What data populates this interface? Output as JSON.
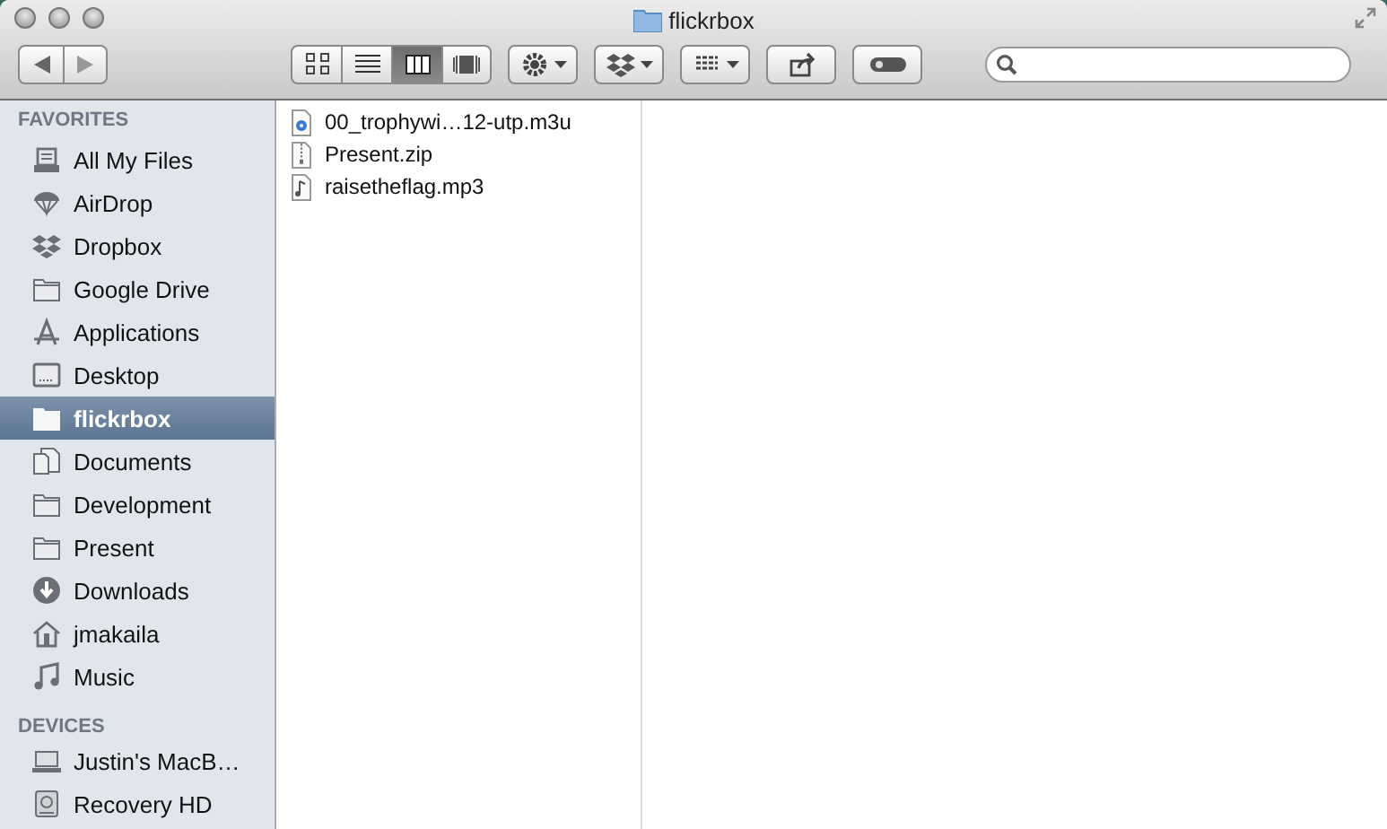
{
  "window": {
    "title": "flickrbox"
  },
  "toolbar": {
    "view_buttons": [
      {
        "kind": "icons",
        "selected": false
      },
      {
        "kind": "list",
        "selected": false
      },
      {
        "kind": "columns",
        "selected": true
      },
      {
        "kind": "coverflow",
        "selected": false
      }
    ],
    "tools": [
      {
        "kind": "gear"
      },
      {
        "kind": "dropbox"
      },
      {
        "kind": "arrange"
      },
      {
        "kind": "share"
      },
      {
        "kind": "toggle"
      }
    ]
  },
  "sidebar": {
    "sections": [
      {
        "header": "FAVORITES",
        "items": [
          {
            "label": "All My Files",
            "kind": "files",
            "selected": false
          },
          {
            "label": "AirDrop",
            "kind": "airdrop",
            "selected": false
          },
          {
            "label": "Dropbox",
            "kind": "dropbox",
            "selected": false
          },
          {
            "label": "Google Drive",
            "kind": "folder",
            "selected": false
          },
          {
            "label": "Applications",
            "kind": "apps",
            "selected": false
          },
          {
            "label": "Desktop",
            "kind": "desktop",
            "selected": false
          },
          {
            "label": "flickrbox",
            "kind": "folder",
            "selected": true
          },
          {
            "label": "Documents",
            "kind": "documents",
            "selected": false
          },
          {
            "label": "Development",
            "kind": "folder",
            "selected": false
          },
          {
            "label": "Present",
            "kind": "folder",
            "selected": false
          },
          {
            "label": "Downloads",
            "kind": "download",
            "selected": false
          },
          {
            "label": "jmakaila",
            "kind": "home",
            "selected": false
          },
          {
            "label": "Music",
            "kind": "music",
            "selected": false
          }
        ]
      },
      {
        "header": "DEVICES",
        "items": [
          {
            "label": "Justin's MacB…",
            "kind": "laptop",
            "selected": false
          },
          {
            "label": "Recovery HD",
            "kind": "disk",
            "selected": false
          }
        ]
      }
    ]
  },
  "columns": [
    {
      "files": [
        {
          "name": "00_trophywi…12-utp.m3u",
          "kind": "playlist"
        },
        {
          "name": "Present.zip",
          "kind": "zip"
        },
        {
          "name": "raisetheflag.mp3",
          "kind": "audio"
        }
      ]
    }
  ]
}
